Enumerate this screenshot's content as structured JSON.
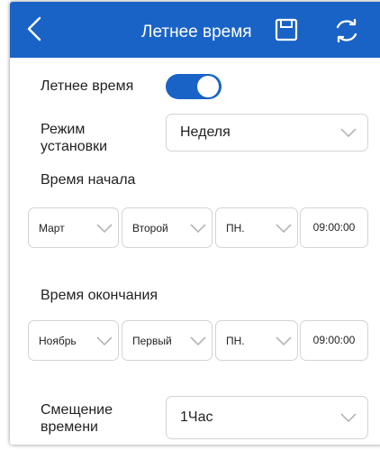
{
  "header": {
    "title": "Летнее время",
    "background": "#1a63c6"
  },
  "dst": {
    "label": "Летнее время",
    "enabled": true
  },
  "mode": {
    "label_line1": "Режим",
    "label_line2": "установки",
    "value": "Неделя"
  },
  "start": {
    "label": "Время начала",
    "month": "Март",
    "week": "Второй",
    "day": "ПН.",
    "time": "09:00:00"
  },
  "end": {
    "label": "Время окончания",
    "month": "Ноябрь",
    "week": "Первый",
    "day": "ПН.",
    "time": "09:00:00"
  },
  "offset": {
    "label_line1": "Смещение",
    "label_line2": "времени",
    "value": "1Час"
  }
}
